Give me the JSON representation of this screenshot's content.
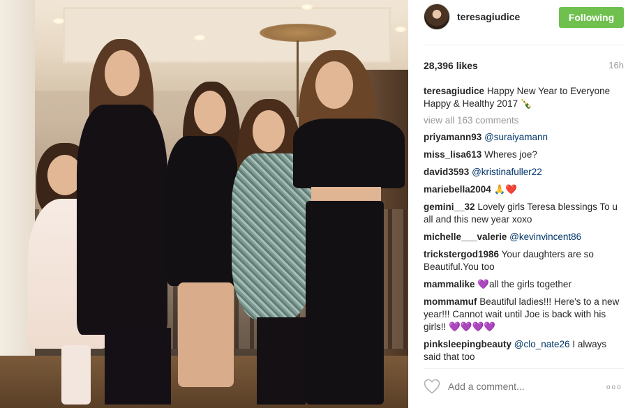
{
  "post": {
    "username": "teresagiudice",
    "follow_label": "Following",
    "likes": "28,396 likes",
    "time_ago": "16h",
    "caption": {
      "user": "teresagiudice",
      "text": "Happy New Year to Everyone Happy & Healthy 2017 🍾"
    },
    "view_all": "view all 163 comments",
    "comments": [
      {
        "user": "priyamann93",
        "mention": "@suraiyamann",
        "text": ""
      },
      {
        "user": "miss_lisa613",
        "mention": "",
        "text": "Wheres joe?"
      },
      {
        "user": "david3593",
        "mention": "@kristinafuller22",
        "text": ""
      },
      {
        "user": "mariebella2004",
        "mention": "",
        "text": "🙏❤️"
      },
      {
        "user": "gemini__32",
        "mention": "",
        "text": "Lovely girls Teresa blessings To u all and this new year xoxo"
      },
      {
        "user": "michelle___valerie",
        "mention": "@kevinvincent86",
        "text": ""
      },
      {
        "user": "trickstergod1986",
        "mention": "",
        "text": "Your daughters are so Beautiful.You too"
      },
      {
        "user": "mammalike",
        "mention": "",
        "text": "💜all the girls together"
      },
      {
        "user": "mommamuf",
        "mention": "",
        "text": "Beautiful ladies!!! Here's to a new year!!! Cannot wait until Joe is back with his girls!! 💜💜💜💜"
      },
      {
        "user": "pinksleepingbeauty",
        "mention": "@clo_nate26",
        "text": "I always said that too"
      }
    ],
    "add_comment_placeholder": "Add a comment...",
    "more_label": "ooo"
  },
  "colors": {
    "follow_button": "#70c050",
    "mention": "#003569",
    "muted": "#999999"
  }
}
